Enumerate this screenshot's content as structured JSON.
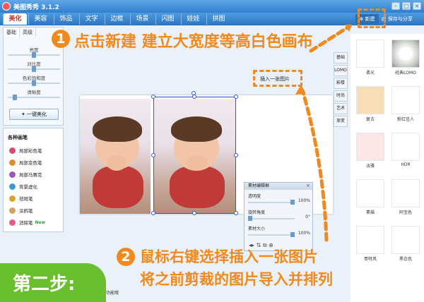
{
  "app": {
    "title": "美图秀秀 3.1.2"
  },
  "tabs": [
    "美化",
    "美容",
    "饰品",
    "文字",
    "边框",
    "场景",
    "闪图",
    "娃娃",
    "拼图"
  ],
  "active_tab": "美化",
  "toolbar": {
    "new_label": "新建",
    "save_label": "保存与分享"
  },
  "left_panel": {
    "tabs": [
      "基础",
      "高级"
    ],
    "sliders": [
      {
        "label": "亮度",
        "value": 0.5
      },
      {
        "label": "对比度",
        "value": 0.5
      },
      {
        "label": "色彩饱和度",
        "value": 0.5
      },
      {
        "label": "清晰度",
        "value": 0.1
      }
    ],
    "one_click_label": "一键美化"
  },
  "brush_panel": {
    "title": "各种画笔",
    "items": [
      "局部彩色笔",
      "局部变色笔",
      "局部马赛克",
      "背景虚化",
      "祛斑笔",
      "涂鸦笔",
      "消除笔"
    ],
    "new_badge": "New",
    "colors": [
      "#d94b6a",
      "#e48b2e",
      "#9b59b6",
      "#3a9ad9",
      "#e0a12a",
      "#d6a15c",
      "#e05c8a"
    ]
  },
  "canvas": {
    "insert_label": "插入一张图片"
  },
  "material_panel": {
    "title": "素材编辑框",
    "rows": [
      {
        "label": "透明度",
        "value": "100%",
        "level": 1.0
      },
      {
        "label": "旋转角度",
        "value": "0°",
        "level": 0.0
      },
      {
        "label": "素材大小",
        "value": "100%",
        "level": 1.0
      }
    ]
  },
  "right_tabs": [
    "基础",
    "LOMO",
    "影楼",
    "时尚",
    "艺术",
    "渐变"
  ],
  "thumbnails": [
    {
      "label": "柔光",
      "color": "#ffffff"
    },
    {
      "label": "经典LOMO",
      "color": "#e6e6e0"
    },
    {
      "label": "复古",
      "color": "#f6dfb6"
    },
    {
      "label": "粉红佳人",
      "color": "#ffffff"
    },
    {
      "label": "淡雅",
      "color": "#fbe7e7"
    },
    {
      "label": "HDR",
      "color": "#ffffff"
    },
    {
      "label": "素描",
      "color": "#ffffff"
    },
    {
      "label": "阿宝色",
      "color": "#ffffff"
    },
    {
      "label": "哥特风",
      "color": "#ffffff"
    },
    {
      "label": "黑白色",
      "color": "#ffffff"
    }
  ],
  "annotations": {
    "step1_num": "1",
    "step1_text": "点击新建 建立大宽度等高白色画布",
    "step2_num": "2",
    "step2_line1": "鼠标右键选择插入一张图片",
    "step2_line2": "将之前剪裁的图片导入并排列",
    "step_label": "第二步:",
    "accent": "#f08a1e",
    "green": "#6abf2f"
  },
  "status": {
    "hint": "功能哦"
  }
}
